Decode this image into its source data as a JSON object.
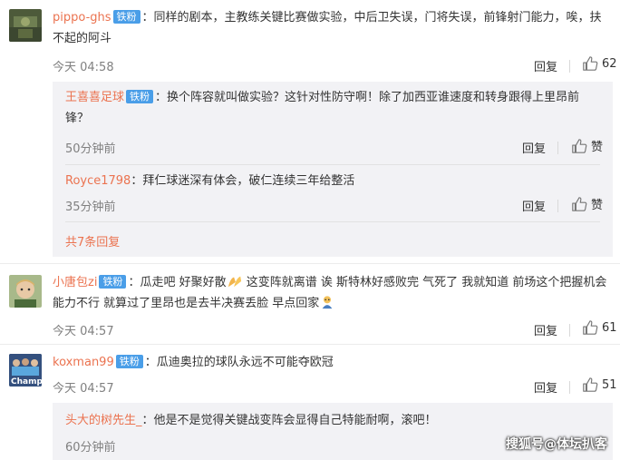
{
  "comments": [
    {
      "username": "pippo-ghs",
      "badge": "铁粉",
      "text": "：同样的剧本，主教练关键比赛做实验，中后卫失误，门将失误，前锋射门能力，唉，扶不起的阿斗",
      "time": "今天 04:58",
      "reply_label": "回复",
      "likes": "62",
      "replies": [
        {
          "username": "王喜喜足球",
          "badge": "铁粉",
          "text": "：换个阵容就叫做实验？这针对性防守啊！除了加西亚谁速度和转身跟得上里昂前锋？",
          "time": "50分钟前",
          "reply_label": "回复",
          "like_label": "赞"
        },
        {
          "username": "Royce1798",
          "text": "：拜仁球迷深有体会，破仁连续三年给整活",
          "time": "35分钟前",
          "reply_label": "回复",
          "like_label": "赞"
        }
      ],
      "more_replies": "共7条回复"
    },
    {
      "username": "小唐包zi",
      "badge": "铁粉",
      "text_a": "：瓜走吧  好聚好散",
      "text_b": " 这变阵就离谱  诶  斯特林好感败完  气死了  我就知道 前场这个把握机会能力不行  就算过了里昂也是去半决赛丢脸  早点回家",
      "time": "今天 04:57",
      "reply_label": "回复",
      "likes": "61"
    },
    {
      "username": "koxman99",
      "badge": "铁粉",
      "text": "：瓜迪奥拉的球队永远不可能夺欧冠",
      "time": "今天 04:57",
      "reply_label": "回复",
      "likes": "51",
      "avatar_text": "Champ",
      "replies": [
        {
          "username": "头大的树先生_",
          "text": "：他是不是觉得关键战变阵会显得自己特能耐啊，滚吧！",
          "time": "60分钟前"
        }
      ]
    }
  ],
  "watermark": "搜狐号@体坛扒客",
  "colors": {
    "username": "#eb7350",
    "badge": "#4a9ee8",
    "sub_bg": "#f2f2f5",
    "meta": "#808080"
  }
}
